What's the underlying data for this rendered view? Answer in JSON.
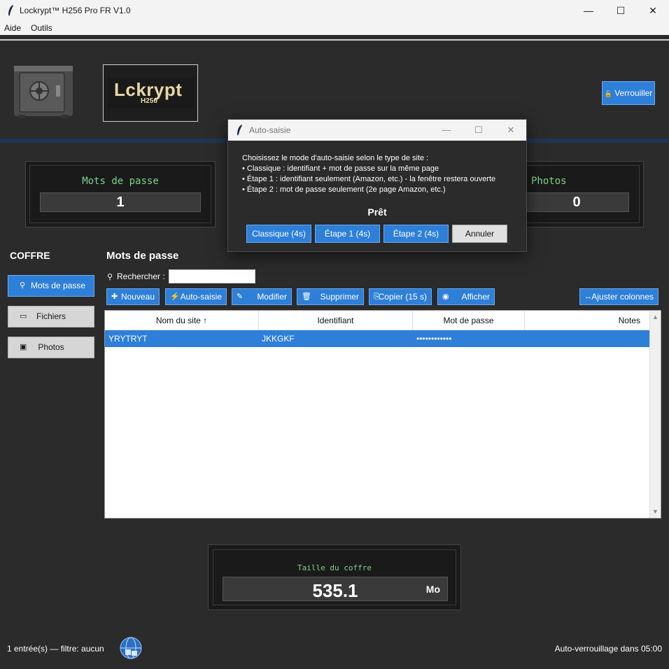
{
  "window": {
    "title": "Lockrypt™ H256 Pro FR V1.0",
    "minimize": "—",
    "maximize": "☐",
    "close": "✕"
  },
  "menu": {
    "items": [
      {
        "label": "Aide"
      },
      {
        "label": "Outils"
      }
    ]
  },
  "header": {
    "logo_main": "Lckrypt",
    "logo_sub": "H256",
    "lock_icon": "🔓",
    "lock_label": "Verrouiller"
  },
  "counters": [
    {
      "label": "Mots de passe",
      "value": "1"
    },
    {
      "label": "Photos",
      "value": "0"
    }
  ],
  "sidebar": {
    "title": "COFFRE",
    "items": [
      {
        "icon": "key-icon",
        "glyph": "⚲",
        "label": "Mots de passe",
        "active": true
      },
      {
        "icon": "folder-icon",
        "glyph": "▭",
        "label": "Fichiers",
        "active": false
      },
      {
        "icon": "picture-icon",
        "glyph": "▣",
        "label": "Photos",
        "active": false
      }
    ]
  },
  "main": {
    "title": "Mots de passe",
    "search_label": "Rechercher :",
    "search_value": "",
    "toolbar": [
      {
        "icon": "plus-icon",
        "glyph": "✚",
        "label": "Nouveau"
      },
      {
        "icon": "lightning-icon",
        "glyph": "⚡",
        "label": "Auto-saisie"
      },
      {
        "icon": "pencil-icon",
        "glyph": "✎",
        "label": "Modifier"
      },
      {
        "icon": "trash-icon",
        "glyph": "🗑",
        "label": "Supprimer"
      },
      {
        "icon": "copy-icon",
        "glyph": "⎘",
        "label": "Copier (15 s)"
      },
      {
        "icon": "eye-icon",
        "glyph": "◉",
        "label": "Afficher"
      },
      {
        "icon": "arrows-icon",
        "glyph": "↔",
        "label": "Ajuster colonnes"
      }
    ],
    "table": {
      "columns": [
        "Nom du site ↑",
        "Identifiant",
        "Mot de passe",
        "Notes"
      ],
      "rows": [
        {
          "site": "YRYTRYT",
          "login": "JKKGKF",
          "password": "••••••••••••",
          "notes": ""
        }
      ]
    }
  },
  "size": {
    "label": "Taille du coffre",
    "value": "535.1",
    "unit": "Mo"
  },
  "status": {
    "left": "1 entrée(s) — filtre: aucun",
    "right": "Auto-verrouillage dans 05:00"
  },
  "dialog": {
    "title": "Auto-saisie",
    "lines": [
      "Choisissez le mode d'auto-saisie selon le type de site :",
      "• Classique : identifiant + mot de passe sur la même page",
      "• Étape 1 : identifiant seulement (Amazon, etc.) - la fenêtre restera ouverte",
      "• Étape 2 : mot de passe seulement (2e page Amazon, etc.)"
    ],
    "status": "Prêt",
    "buttons": [
      "Classique (4s)",
      "Étape 1 (4s)",
      "Étape 2 (4s)",
      "Annuler"
    ]
  },
  "colors": {
    "accent": "#2e7fd8",
    "background": "#2b2b2b",
    "counter_label": "#7fd18a"
  }
}
